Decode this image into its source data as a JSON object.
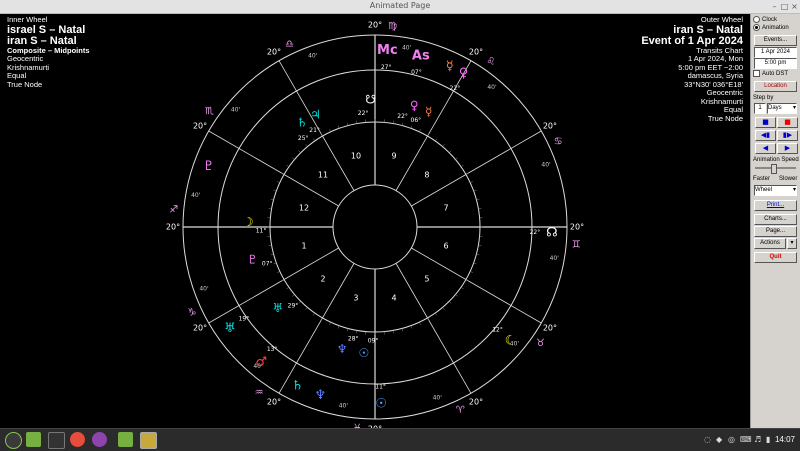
{
  "window": {
    "title": "Animated Page"
  },
  "inner": {
    "heading": "Inner Wheel",
    "name1": "israel S – Natal",
    "name2": "iran S – Natal",
    "type": "Composite – Midpoints",
    "zodiac": "Geocentric",
    "ayanamsa": "Krishnamurti",
    "houses": "Equal",
    "node": "True Node"
  },
  "outer": {
    "heading": "Outer Wheel",
    "name": "iran S – Natal",
    "event": "Event of 1 Apr 2024",
    "chart_type": "Transits Chart",
    "date": "1 Apr 2024, Mon",
    "time": "5:00 pm  EET −2:00",
    "place": "damascus, Syria",
    "coords": "33°N30' 036°E18'",
    "zodiac": "Geocentric",
    "ayanamsa": "Krishnamurti",
    "houses": "Equal",
    "node": "True Node"
  },
  "panel": {
    "radio_clock": "Clock",
    "radio_animation": "Animation",
    "events_btn": "Events...",
    "date_value": "1 Apr 2024",
    "time_value": "5:00 pm",
    "auto_dst": "Auto DST",
    "location_btn": "Location",
    "step_label": "Step by",
    "step_value": "1",
    "step_unit": "Days",
    "speed_label": "Animation Speed",
    "faster": "Faster",
    "slower": "Slower",
    "wheel_select": "Wheel",
    "print_btn": "Print...",
    "charts_btn": "Charts...",
    "page_btn": "Page...",
    "actions_btn": "Actions",
    "quit_btn": "Quit"
  },
  "taskbar": {
    "clock": "14:07"
  },
  "wheel": {
    "house_numbers": [
      "1",
      "2",
      "3",
      "4",
      "5",
      "6",
      "7",
      "8",
      "9",
      "10",
      "11",
      "12"
    ],
    "cusps": [
      {
        "deg": "20°",
        "sign": "♐",
        "min": "40'"
      },
      {
        "deg": "20°",
        "sign": "♑",
        "min": "40'"
      },
      {
        "deg": "20°",
        "sign": "♒",
        "min": "40'"
      },
      {
        "deg": "20°",
        "sign": "♓",
        "min": "40'"
      },
      {
        "deg": "20°",
        "sign": "♈",
        "min": "40'"
      },
      {
        "deg": "20°",
        "sign": "♉",
        "min": "40'"
      },
      {
        "deg": "20°",
        "sign": "♊",
        "min": "40'"
      },
      {
        "deg": "20°",
        "sign": "♋",
        "min": "40'"
      },
      {
        "deg": "20°",
        "sign": "♌",
        "min": "40'"
      },
      {
        "deg": "20°",
        "sign": "♍",
        "min": "40'"
      },
      {
        "deg": "20°",
        "sign": "♎",
        "min": "40'"
      },
      {
        "deg": "20°",
        "sign": "♏",
        "min": "40'"
      }
    ],
    "outer_glyphs": [
      {
        "g": "As",
        "c": "#f080f0",
        "deg": "07°",
        "pos": "a1"
      },
      {
        "g": "Mc",
        "c": "#f080f0",
        "deg": "27°",
        "pos": "a2"
      },
      {
        "g": "☿",
        "c": "#ff8040",
        "deg": "",
        "pos": "a3"
      },
      {
        "g": "♀",
        "c": "#ff66ff",
        "deg": "22°",
        "pos": "a4"
      },
      {
        "g": "☊",
        "c": "#ffffff",
        "deg": "22°",
        "pos": "a5"
      },
      {
        "g": "☾",
        "c": "#ffff00",
        "deg": "12°",
        "pos": "a6"
      },
      {
        "g": "☉",
        "c": "#40a0ff",
        "deg": "11°",
        "pos": "a7"
      },
      {
        "g": "♂",
        "c": "#ff4040",
        "deg": "13°",
        "pos": "a8"
      },
      {
        "g": "♄",
        "c": "#00e0e0",
        "deg": "",
        "pos": "a9"
      },
      {
        "g": "♅",
        "c": "#00e0e0",
        "deg": "19°",
        "pos": "a10"
      },
      {
        "g": "♆",
        "c": "#6080ff",
        "deg": "",
        "pos": "a11"
      },
      {
        "g": "♇",
        "c": "#ff80ff",
        "deg": "",
        "pos": "a12"
      }
    ],
    "inner_glyphs": [
      {
        "g": "☽",
        "c": "#ffff00",
        "deg": "11°"
      },
      {
        "g": "♄",
        "c": "#00e0e0",
        "deg": "25°"
      },
      {
        "g": "♃",
        "c": "#00e0e0",
        "deg": "21°"
      },
      {
        "g": "♀",
        "c": "#ff66ff",
        "deg": "22°"
      },
      {
        "g": "☿",
        "c": "#ff8040",
        "deg": "06°"
      },
      {
        "g": "☋",
        "c": "#ffffff",
        "deg": "22°"
      },
      {
        "g": "☉",
        "c": "#40a0ff",
        "deg": "09°"
      },
      {
        "g": "♆",
        "c": "#6080ff",
        "deg": "28°"
      },
      {
        "g": "♅",
        "c": "#00e0e0",
        "deg": "29°"
      },
      {
        "g": "♇",
        "c": "#ff80ff",
        "deg": "07°"
      }
    ]
  }
}
